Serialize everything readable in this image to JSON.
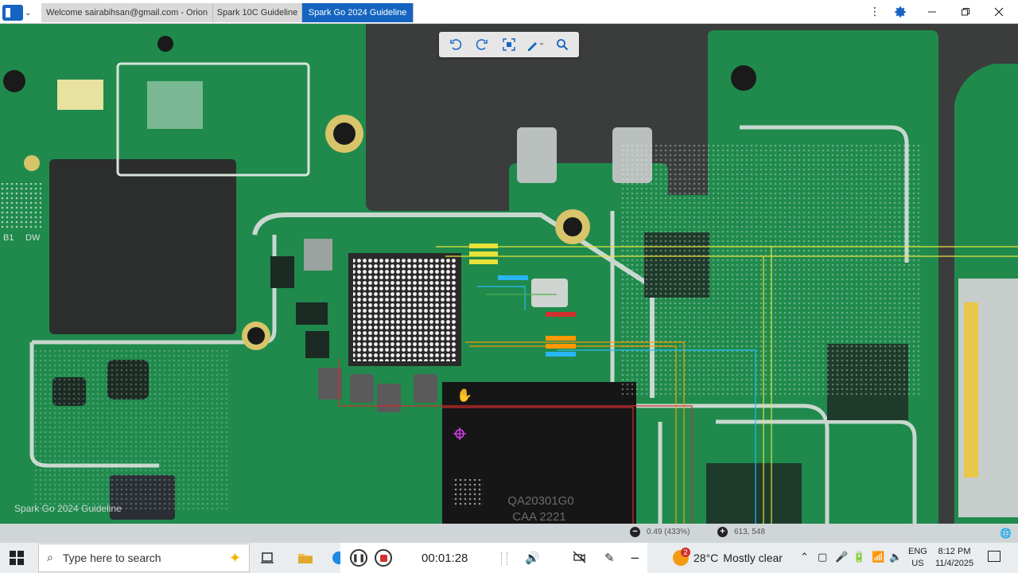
{
  "window": {
    "tabs": [
      {
        "label": "Welcome sairabihsan@gmail.com - Orion",
        "active": false
      },
      {
        "label": "Spark 10C Guideline",
        "active": false
      },
      {
        "label": "Spark Go 2024 Guideline",
        "active": true
      }
    ],
    "accent": "#1565c0",
    "controls": [
      "more-vertical-icon",
      "gear-icon",
      "minimize-icon",
      "maximize-icon",
      "close-icon"
    ]
  },
  "toolbar": {
    "icons": [
      "rotate-left-icon",
      "rotate-right-icon",
      "fit-screen-icon",
      "highlight-pen-icon",
      "search-icon"
    ]
  },
  "board": {
    "watermark": "Spark Go 2024 Guideline",
    "chip_marking_1": "QA20301G0",
    "chip_marking_2": "CAA    2221",
    "silkscreen_b1": "B1",
    "silkscreen_dw": "DW",
    "colors": {
      "pcb": "#1f8a4c",
      "trace_red": "#d32f2f",
      "trace_yellow": "#e8e23a",
      "trace_blue": "#29b6f6",
      "trace_orange": "#ff9800"
    }
  },
  "status": {
    "zoom": "0.49 (433%)",
    "coords": "613, 548"
  },
  "taskbar": {
    "search_placeholder": "Type here to search",
    "recorder_time": "00:01:28",
    "weather_temp": "28°C",
    "weather_text": "Mostly clear",
    "weather_badge": "2",
    "lang_1": "ENG",
    "lang_2": "US",
    "time": "8:12 PM",
    "date": "11/4/2025"
  }
}
